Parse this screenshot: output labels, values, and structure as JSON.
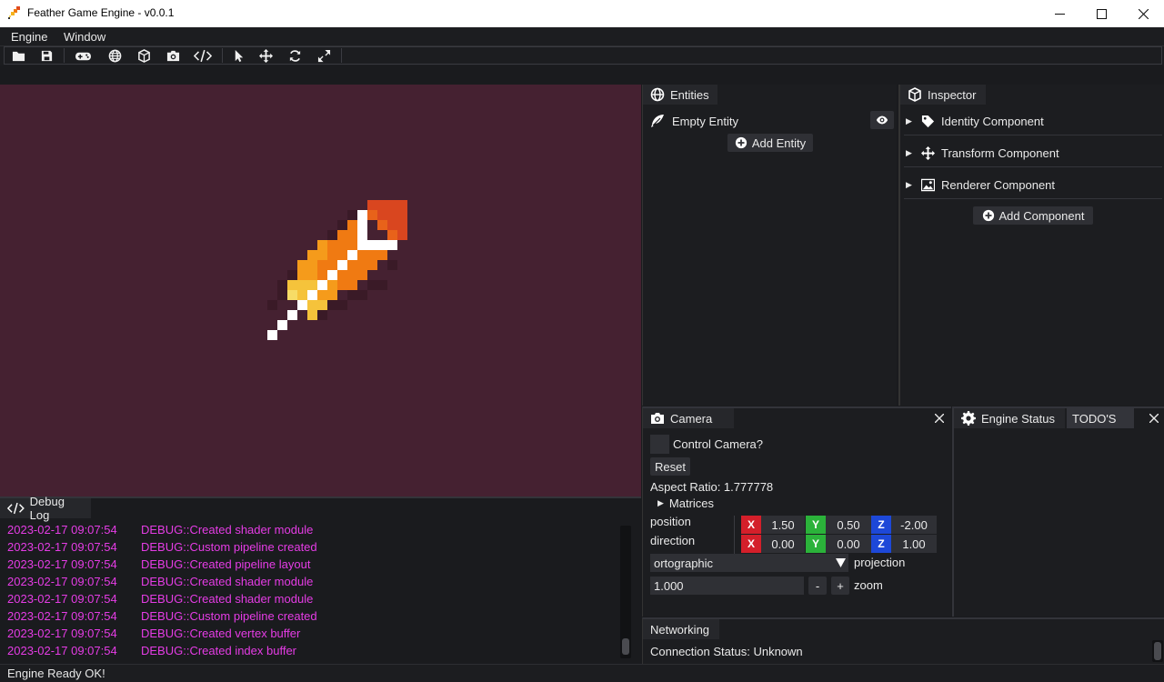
{
  "window": {
    "title": "Feather Game Engine - v0.0.1",
    "minimize": "—",
    "maximize": "☐",
    "close": "✕"
  },
  "menu": {
    "items": [
      "Engine",
      "Window"
    ]
  },
  "toolbar": {
    "icons": [
      "folder-icon",
      "save-icon",
      "gamepad-icon",
      "globe-icon",
      "cube-icon",
      "camera-icon",
      "code-icon",
      "pointer-icon",
      "move-icon",
      "refresh-icon",
      "expand-icon"
    ]
  },
  "debug_log": {
    "tab_label": "Debug Log",
    "lines": [
      {
        "time": "2023-02-17 09:07:54",
        "message": "DEBUG::Created shader module"
      },
      {
        "time": "2023-02-17 09:07:54",
        "message": "DEBUG::Custom pipeline created"
      },
      {
        "time": "2023-02-17 09:07:54",
        "message": "DEBUG::Created pipeline layout"
      },
      {
        "time": "2023-02-17 09:07:54",
        "message": "DEBUG::Created shader module"
      },
      {
        "time": "2023-02-17 09:07:54",
        "message": "DEBUG::Created shader module"
      },
      {
        "time": "2023-02-17 09:07:54",
        "message": "DEBUG::Custom pipeline created"
      },
      {
        "time": "2023-02-17 09:07:54",
        "message": "DEBUG::Created vertex buffer"
      },
      {
        "time": "2023-02-17 09:07:54",
        "message": "DEBUG::Created index buffer"
      }
    ],
    "color": "#e53ce5"
  },
  "status_bar": {
    "text": "Engine Ready OK!"
  },
  "entities": {
    "title": "Entities",
    "items": [
      {
        "name": "Empty Entity"
      }
    ],
    "add_label": "Add Entity"
  },
  "inspector": {
    "title": "Inspector",
    "components": [
      {
        "label": "Identity Component",
        "icon": "tag-icon"
      },
      {
        "label": "Transform Component",
        "icon": "move-icon"
      },
      {
        "label": "Renderer Component",
        "icon": "image-icon"
      }
    ],
    "add_label": "Add Component"
  },
  "camera": {
    "title": "Camera",
    "control_label": "Control Camera?",
    "control_checked": false,
    "reset_label": "Reset",
    "aspect_ratio": "Aspect Ratio: 1.777778",
    "matrices_label": "Matrices",
    "position_label": "position",
    "direction_label": "direction",
    "position": {
      "x": "1.50",
      "y": "0.50",
      "z": "-2.00"
    },
    "direction": {
      "x": "0.00",
      "y": "0.00",
      "z": "1.00"
    },
    "projection_value": "ortographic",
    "projection_label": "projection",
    "zoom_value": "1.000",
    "zoom_minus": "-",
    "zoom_plus": "+",
    "zoom_label": "zoom",
    "axis_labels": {
      "x": "X",
      "y": "Y",
      "z": "Z"
    }
  },
  "engine_status": {
    "title": "Engine Status",
    "tab2": "TODO'S"
  },
  "networking": {
    "title": "Networking",
    "connection": "Connection Status: Unknown"
  },
  "colors": {
    "viewport_bg": "#452131",
    "axis_x": "#d41f2a",
    "axis_y": "#2bb23a",
    "axis_z": "#1d48d8"
  }
}
